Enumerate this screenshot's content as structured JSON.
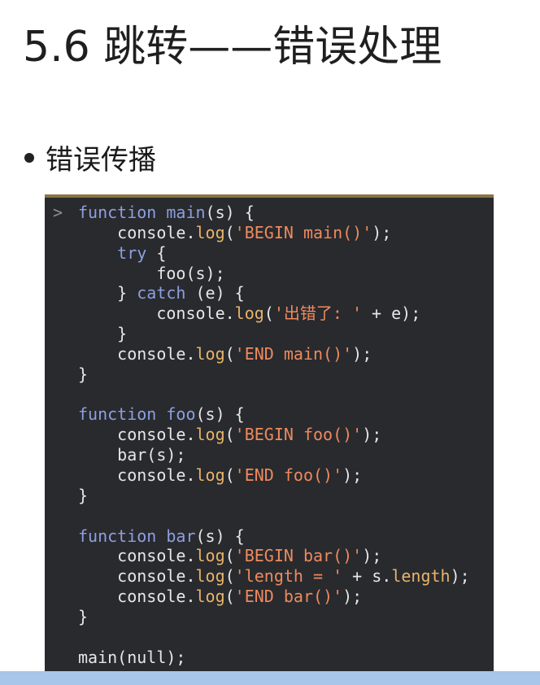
{
  "slide": {
    "title": "5.6 跳转——错误处理",
    "bullet": "错误传播"
  },
  "terminal": {
    "prompt": ">"
  },
  "code": {
    "lines": [
      [
        {
          "t": "function",
          "c": "kw"
        },
        {
          "t": " ",
          "c": "plain"
        },
        {
          "t": "main",
          "c": "fn"
        },
        {
          "t": "(s) {",
          "c": "plain"
        }
      ],
      [
        {
          "t": "    console.",
          "c": "plain"
        },
        {
          "t": "log",
          "c": "method"
        },
        {
          "t": "(",
          "c": "plain"
        },
        {
          "t": "'BEGIN main()'",
          "c": "str"
        },
        {
          "t": ");",
          "c": "plain"
        }
      ],
      [
        {
          "t": "    ",
          "c": "plain"
        },
        {
          "t": "try",
          "c": "kw"
        },
        {
          "t": " {",
          "c": "plain"
        }
      ],
      [
        {
          "t": "        foo(s);",
          "c": "plain"
        }
      ],
      [
        {
          "t": "    } ",
          "c": "plain"
        },
        {
          "t": "catch",
          "c": "kw"
        },
        {
          "t": " (e) {",
          "c": "plain"
        }
      ],
      [
        {
          "t": "        console.",
          "c": "plain"
        },
        {
          "t": "log",
          "c": "method"
        },
        {
          "t": "(",
          "c": "plain"
        },
        {
          "t": "'出错了: '",
          "c": "str"
        },
        {
          "t": " + e);",
          "c": "plain"
        }
      ],
      [
        {
          "t": "    }",
          "c": "plain"
        }
      ],
      [
        {
          "t": "    console.",
          "c": "plain"
        },
        {
          "t": "log",
          "c": "method"
        },
        {
          "t": "(",
          "c": "plain"
        },
        {
          "t": "'END main()'",
          "c": "str"
        },
        {
          "t": ");",
          "c": "plain"
        }
      ],
      [
        {
          "t": "}",
          "c": "plain"
        }
      ],
      [],
      [
        {
          "t": "function",
          "c": "kw"
        },
        {
          "t": " ",
          "c": "plain"
        },
        {
          "t": "foo",
          "c": "fn"
        },
        {
          "t": "(s) {",
          "c": "plain"
        }
      ],
      [
        {
          "t": "    console.",
          "c": "plain"
        },
        {
          "t": "log",
          "c": "method"
        },
        {
          "t": "(",
          "c": "plain"
        },
        {
          "t": "'BEGIN foo()'",
          "c": "str"
        },
        {
          "t": ");",
          "c": "plain"
        }
      ],
      [
        {
          "t": "    bar(s);",
          "c": "plain"
        }
      ],
      [
        {
          "t": "    console.",
          "c": "plain"
        },
        {
          "t": "log",
          "c": "method"
        },
        {
          "t": "(",
          "c": "plain"
        },
        {
          "t": "'END foo()'",
          "c": "str"
        },
        {
          "t": ");",
          "c": "plain"
        }
      ],
      [
        {
          "t": "}",
          "c": "plain"
        }
      ],
      [],
      [
        {
          "t": "function",
          "c": "kw"
        },
        {
          "t": " ",
          "c": "plain"
        },
        {
          "t": "bar",
          "c": "fn"
        },
        {
          "t": "(s) {",
          "c": "plain"
        }
      ],
      [
        {
          "t": "    console.",
          "c": "plain"
        },
        {
          "t": "log",
          "c": "method"
        },
        {
          "t": "(",
          "c": "plain"
        },
        {
          "t": "'BEGIN bar()'",
          "c": "str"
        },
        {
          "t": ");",
          "c": "plain"
        }
      ],
      [
        {
          "t": "    console.",
          "c": "plain"
        },
        {
          "t": "log",
          "c": "method"
        },
        {
          "t": "(",
          "c": "plain"
        },
        {
          "t": "'length = '",
          "c": "str"
        },
        {
          "t": " + s.",
          "c": "plain"
        },
        {
          "t": "length",
          "c": "method"
        },
        {
          "t": ");",
          "c": "plain"
        }
      ],
      [
        {
          "t": "    console.",
          "c": "plain"
        },
        {
          "t": "log",
          "c": "method"
        },
        {
          "t": "(",
          "c": "plain"
        },
        {
          "t": "'END bar()'",
          "c": "str"
        },
        {
          "t": ");",
          "c": "plain"
        }
      ],
      [
        {
          "t": "}",
          "c": "plain"
        }
      ],
      [],
      [
        {
          "t": "main(",
          "c": "plain"
        },
        {
          "t": "null",
          "c": "null"
        },
        {
          "t": ");",
          "c": "plain"
        }
      ]
    ]
  },
  "colors": {
    "code_background": "#282a2e",
    "keyword": "#8e9fe0",
    "method": "#e8b46a",
    "string": "#ef8a5d",
    "panel_top_border": "#8a7440",
    "bottom_bar": "#a7c6e8"
  }
}
